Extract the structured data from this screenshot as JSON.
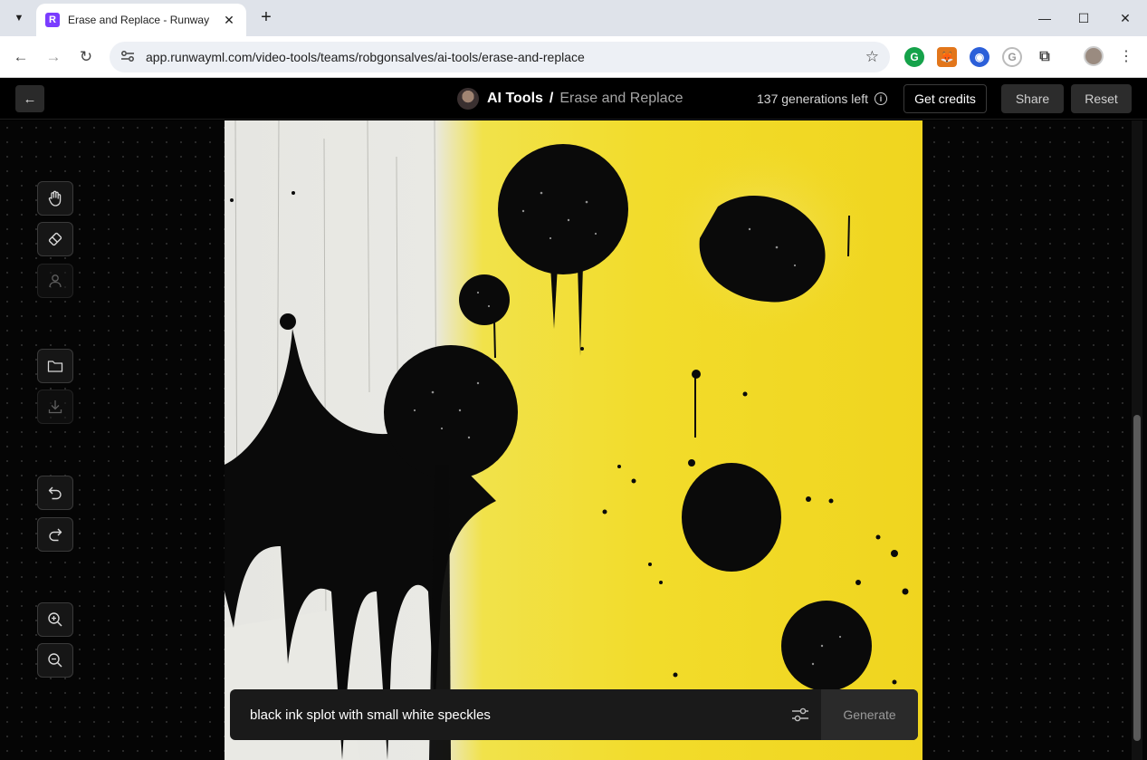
{
  "browser": {
    "tab_title": "Erase and Replace - Runway",
    "favicon_letter": "R",
    "url": "app.runwayml.com/video-tools/teams/robgonsalves/ai-tools/erase-and-replace"
  },
  "header": {
    "breadcrumb_root": "AI Tools",
    "breadcrumb_separator": "/",
    "breadcrumb_page": "Erase and Replace",
    "generations_left": "137 generations left",
    "get_credits_label": "Get credits",
    "share_label": "Share",
    "reset_label": "Reset"
  },
  "tools": [
    {
      "name": "hand",
      "icon": "hand-icon",
      "enabled": true
    },
    {
      "name": "eraser",
      "icon": "eraser-icon",
      "enabled": true
    },
    {
      "name": "subject-select",
      "icon": "person-icon",
      "enabled": false
    },
    {
      "name": "open-file",
      "icon": "folder-icon",
      "enabled": true
    },
    {
      "name": "download",
      "icon": "download-icon",
      "enabled": false
    },
    {
      "name": "undo",
      "icon": "undo-icon",
      "enabled": true
    },
    {
      "name": "redo",
      "icon": "redo-icon",
      "enabled": true
    },
    {
      "name": "zoom-in",
      "icon": "zoom-in-icon",
      "enabled": true
    },
    {
      "name": "zoom-out",
      "icon": "zoom-out-icon",
      "enabled": true
    }
  ],
  "prompt": {
    "value": "black ink splot with small white speckles",
    "generate_label": "Generate"
  },
  "colors": {
    "accent": "#7a3cff",
    "canvas_yellow": "#f2dc2b",
    "ink": "#0a0a0a"
  }
}
